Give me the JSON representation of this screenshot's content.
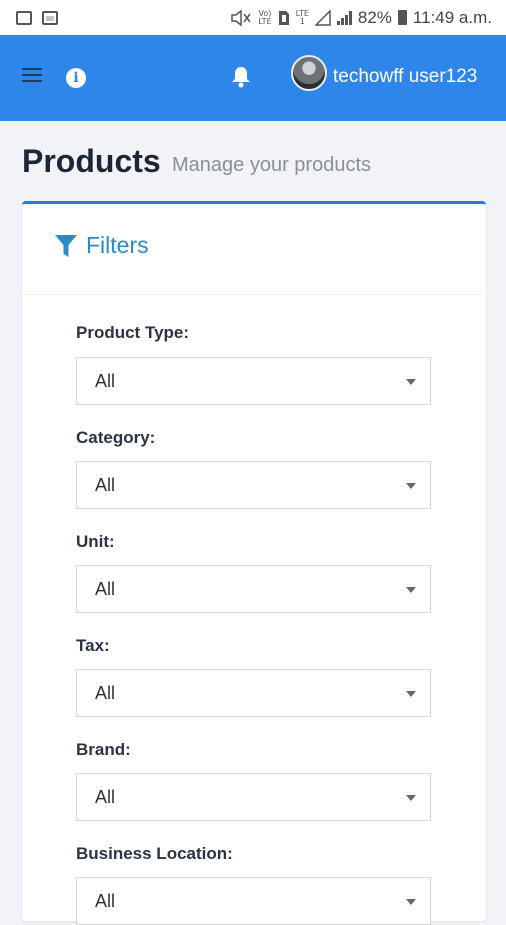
{
  "status_bar": {
    "net1_top": "Vo)",
    "net1_bottom": "LTE",
    "net2_top": "LTE",
    "net2_bottom": "1",
    "battery_percent": "82%",
    "time": "11:49 a.m."
  },
  "app_bar": {
    "username": "techowff user123",
    "colors": {
      "bar": "#2f86ea",
      "text": "#ffffff"
    },
    "icons": [
      "menu-icon",
      "info-icon",
      "bell-icon",
      "avatar"
    ]
  },
  "header": {
    "title": "Products",
    "subtitle": "Manage your products"
  },
  "filters": {
    "heading": "Filters",
    "accent_color": "#2a8bc9",
    "fields": [
      {
        "label": "Product Type:",
        "value": "All"
      },
      {
        "label": "Category:",
        "value": "All"
      },
      {
        "label": "Unit:",
        "value": "All"
      },
      {
        "label": "Tax:",
        "value": "All"
      },
      {
        "label": "Brand:",
        "value": "All"
      },
      {
        "label": "Business Location:",
        "value": "All"
      }
    ]
  }
}
